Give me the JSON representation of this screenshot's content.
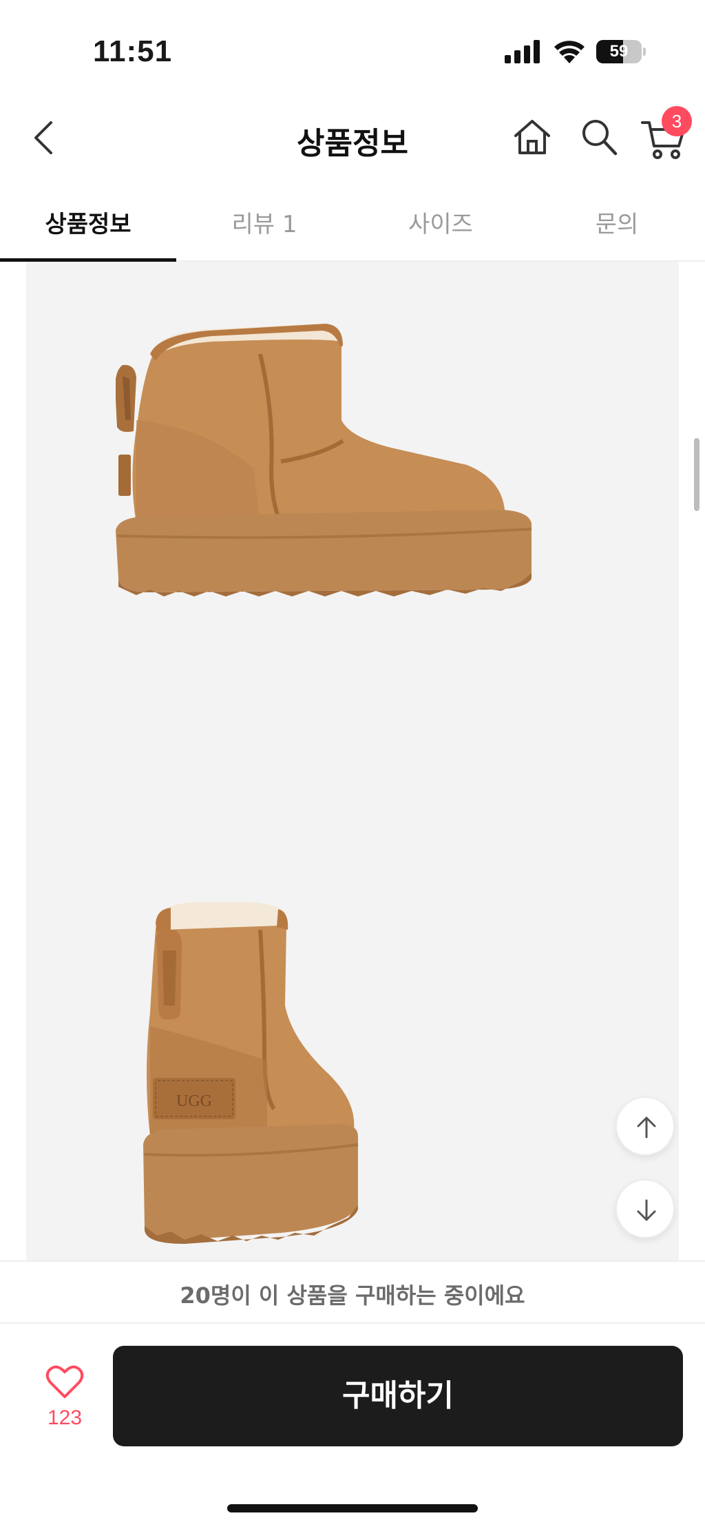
{
  "status_bar": {
    "time": "11:51",
    "battery_level": "59",
    "battery_fraction": 0.59
  },
  "header": {
    "title": "상품정보",
    "cart_count": "3"
  },
  "tabs": [
    {
      "label": "상품정보",
      "active": true
    },
    {
      "label": "리뷰 1",
      "active": false
    },
    {
      "label": "사이즈",
      "active": false
    },
    {
      "label": "문의",
      "active": false
    }
  ],
  "product_images": [
    {
      "name": "boot-side-view",
      "brand_label": ""
    },
    {
      "name": "boot-back-view",
      "brand_label": "UGG"
    }
  ],
  "notice": {
    "text": "20명이 이 상품을 구매하는 중이에요"
  },
  "bottom_bar": {
    "like_count": "123",
    "buy_label": "구매하기"
  },
  "colors": {
    "accent": "#ff4b5f",
    "buy_button": "#1c1c1c",
    "boot": "#c68d55",
    "sole": "#bd8754"
  }
}
